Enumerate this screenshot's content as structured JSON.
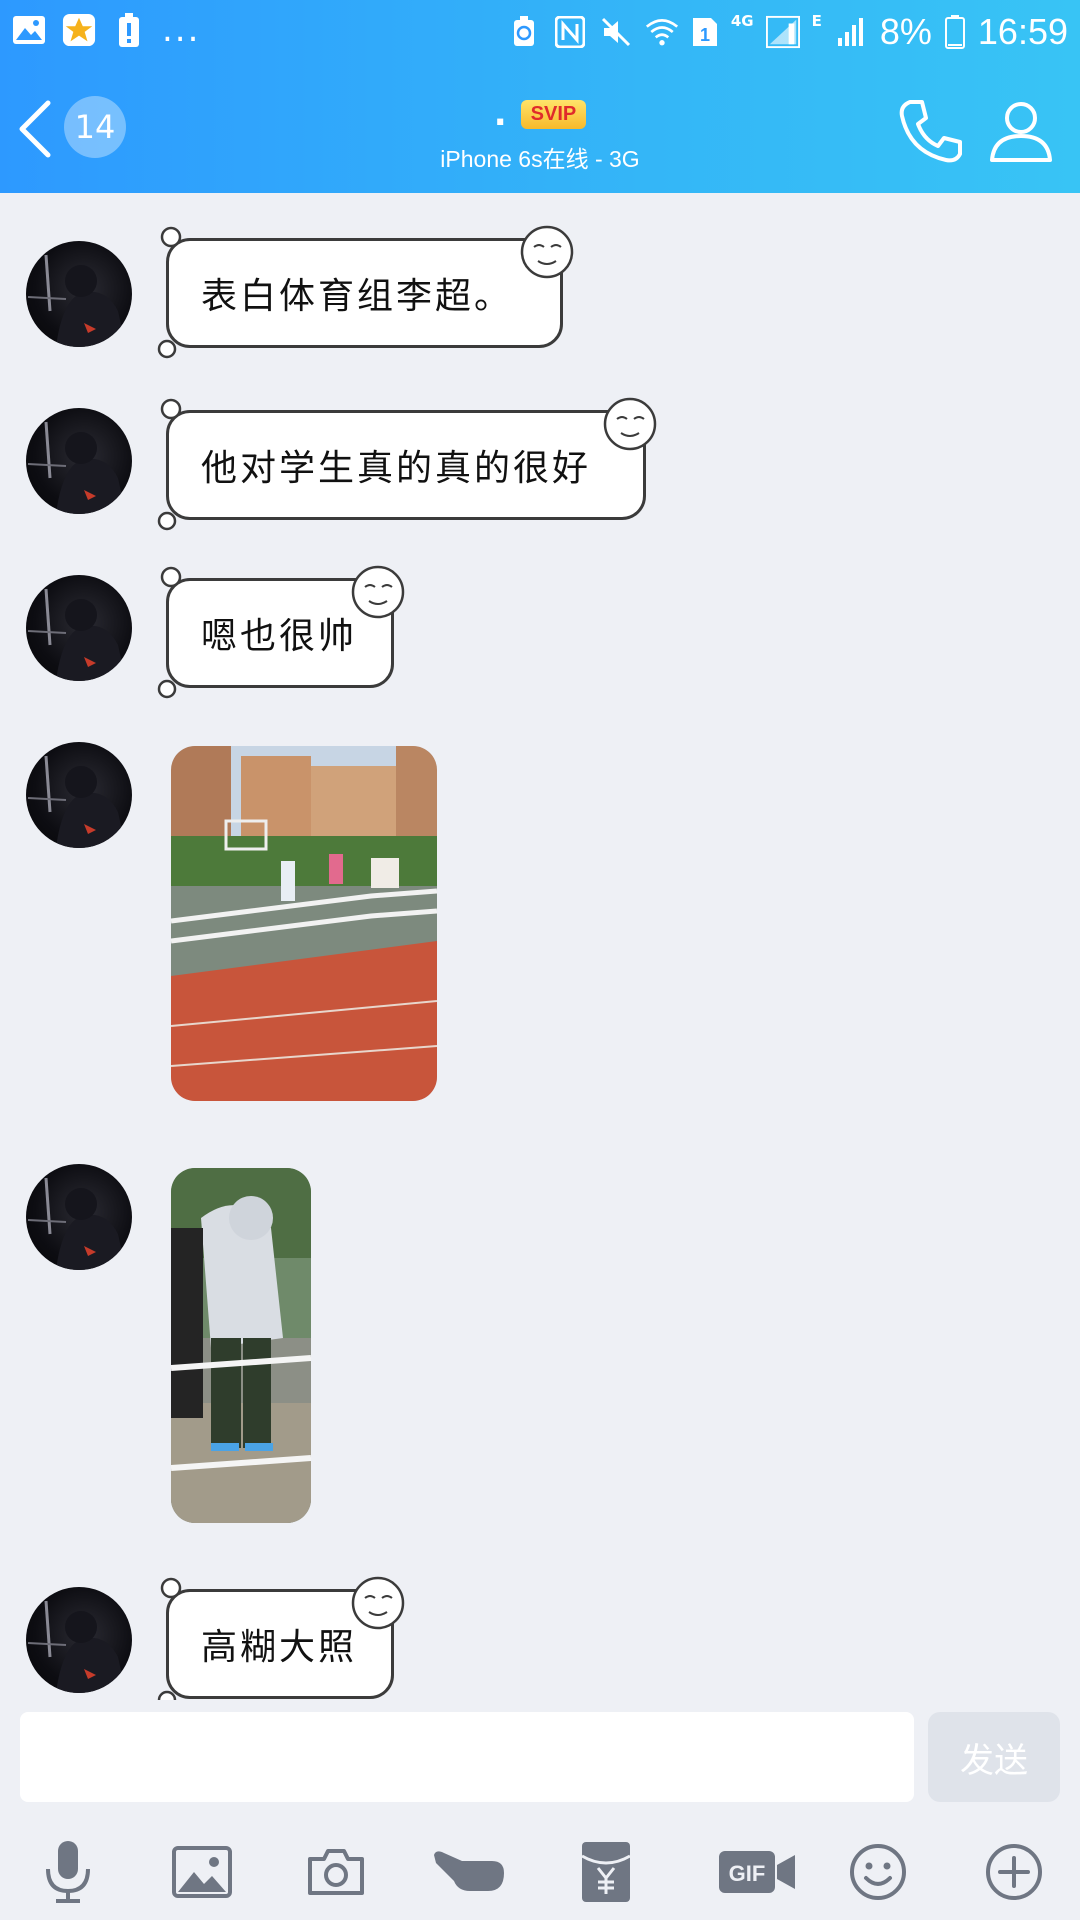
{
  "status_bar": {
    "battery_percent": "8%",
    "time": "16:59",
    "sim_badge": "1",
    "network_4g": "4G",
    "network_e": "E",
    "overflow": "..."
  },
  "header": {
    "unread_count": "14",
    "contact_name": ".",
    "svip_label": "SVIP",
    "online_status": "iPhone 6s在线 - 3G"
  },
  "messages": [
    {
      "type": "text",
      "text": "表白体育组李超。"
    },
    {
      "type": "text",
      "text": "他对学生真的真的很好"
    },
    {
      "type": "text",
      "text": "嗯也很帅"
    },
    {
      "type": "image"
    },
    {
      "type": "image"
    },
    {
      "type": "text",
      "text": "高糊大照"
    }
  ],
  "composer": {
    "placeholder": "",
    "send_label": "发送"
  },
  "toolbar": {
    "icons": [
      "microphone-icon",
      "image-icon",
      "camera-icon",
      "poke-hand-icon",
      "red-packet-icon",
      "gif-icon",
      "emoji-icon",
      "plus-icon"
    ]
  },
  "colors": {
    "header_start": "#2d99ff",
    "header_end": "#38c4f5",
    "background": "#eef0f5",
    "svip_text": "#e02b2b",
    "svip_bg": "#f7c531"
  }
}
